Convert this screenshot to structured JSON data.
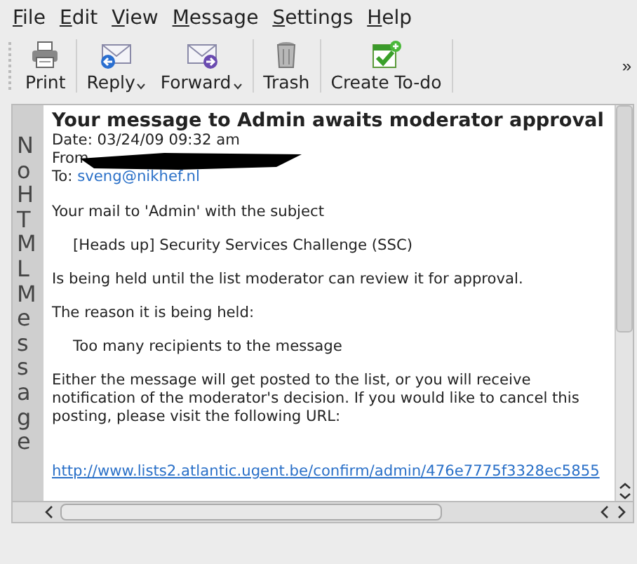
{
  "menu": [
    {
      "label": "File"
    },
    {
      "label": "Edit"
    },
    {
      "label": "View"
    },
    {
      "label": "Message"
    },
    {
      "label": "Settings"
    },
    {
      "label": "Help"
    }
  ],
  "toolbar": {
    "buttons": [
      {
        "kind": "print",
        "label": "Print",
        "dropdown": false
      },
      {
        "kind": "reply",
        "label": "Reply",
        "dropdown": true
      },
      {
        "kind": "forward",
        "label": "Forward",
        "dropdown": true
      },
      {
        "kind": "trash",
        "label": "Trash",
        "dropdown": false
      },
      {
        "kind": "todo",
        "label": "Create To-do",
        "dropdown": false
      }
    ],
    "overflow": "»"
  },
  "side_label": "No HTML Message",
  "message": {
    "subject": "Your message to Admin awaits moderator approval",
    "date": "Date: 03/24/09 09:32 am",
    "from_label": "From",
    "to_label": "To:",
    "to": "sveng@nikhef.nl",
    "body": [
      {
        "kind": "para",
        "text": "Your mail to 'Admin' with the subject"
      },
      {
        "kind": "indent",
        "text": "[Heads up] Security Services Challenge  (SSC)"
      },
      {
        "kind": "para",
        "text": "Is being held until the list moderator can review it for approval."
      },
      {
        "kind": "para",
        "text": "The reason it is being held:"
      },
      {
        "kind": "indent",
        "text": "Too many recipients to the message"
      },
      {
        "kind": "para",
        "text": "Either the message will get posted to the list, or you will receive notification of the moderator's decision.  If you would like to cancel this posting, please visit the following URL:"
      },
      {
        "kind": "link",
        "text": "http://www.lists2.atlantic.ugent.be/confirm/admin/476e7775f3328ec5855"
      }
    ]
  }
}
